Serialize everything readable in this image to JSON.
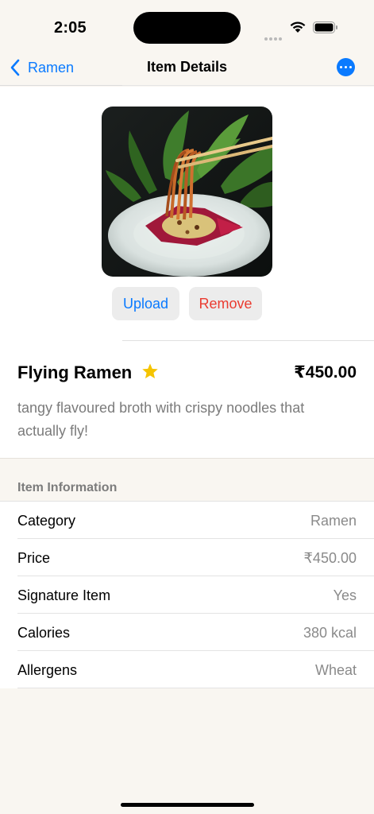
{
  "status_bar": {
    "time": "2:05"
  },
  "nav": {
    "back_label": "Ramen",
    "title": "Item Details",
    "more_icon": "ellipsis-circle-icon"
  },
  "photo": {
    "description_icon": "food-photo"
  },
  "buttons": {
    "upload": "Upload",
    "remove": "Remove"
  },
  "item": {
    "name": "Flying Ramen",
    "price": "₹450.00",
    "description": "tangy flavoured broth with crispy noodles that actually fly!",
    "star_color": "#f5c400"
  },
  "info": {
    "header": "Item Information",
    "rows": [
      {
        "label": "Category",
        "value": "Ramen"
      },
      {
        "label": "Price",
        "value": "₹450.00"
      },
      {
        "label": "Signature Item",
        "value": "Yes"
      },
      {
        "label": "Calories",
        "value": "380 kcal"
      },
      {
        "label": "Allergens",
        "value": "Wheat"
      }
    ]
  },
  "colors": {
    "accent": "#0a7aff",
    "destructive": "#ea3b30",
    "background": "#f9f6f1"
  }
}
